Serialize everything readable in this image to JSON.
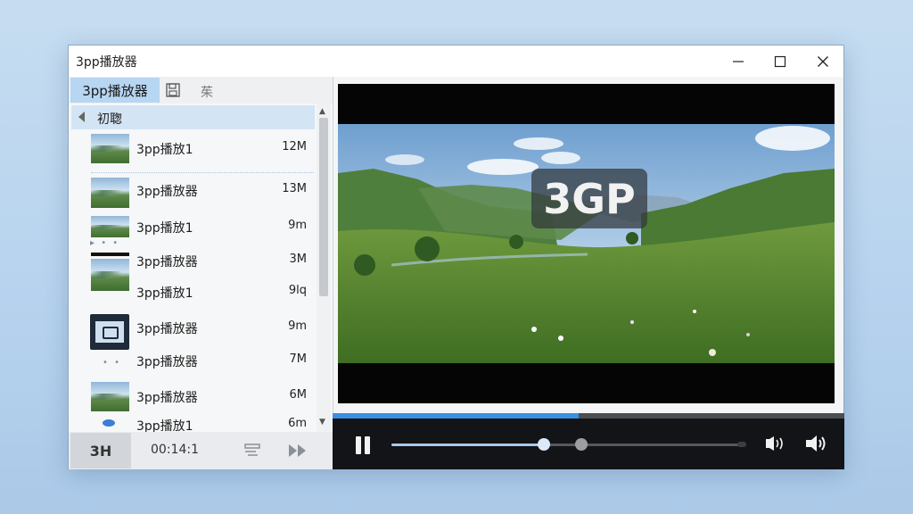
{
  "window": {
    "title": "3pp播放器",
    "controls": [
      "minimize",
      "maximize",
      "close"
    ]
  },
  "toolbar": {
    "tab_label": "3pp播放器",
    "save_icon": "save-icon",
    "extra_label": "茱"
  },
  "playlist": {
    "folder_label": "初聦",
    "items": [
      {
        "name": "3pp播放1",
        "size": "12M"
      },
      {
        "name": "3pp播放器",
        "size": "13M"
      },
      {
        "name": "3pp播放1",
        "size": "9m"
      },
      {
        "name": "3pp播放器",
        "size": "3M"
      },
      {
        "name": "3pp播放1",
        "size": "9lq"
      },
      {
        "name": "3pp播放器",
        "size": "9m"
      },
      {
        "name": "3pp播放器",
        "size": "7M"
      },
      {
        "name": "3pp播放器",
        "size": "6M"
      },
      {
        "name": "3pp播放1",
        "size": "6m"
      }
    ]
  },
  "bottombar": {
    "left_label": "3H",
    "time": "00:14:1"
  },
  "player": {
    "badge_text": "3GP",
    "progress_fraction": 0.48,
    "seek_fraction": 0.43,
    "accent_color": "#3a8fe0"
  }
}
